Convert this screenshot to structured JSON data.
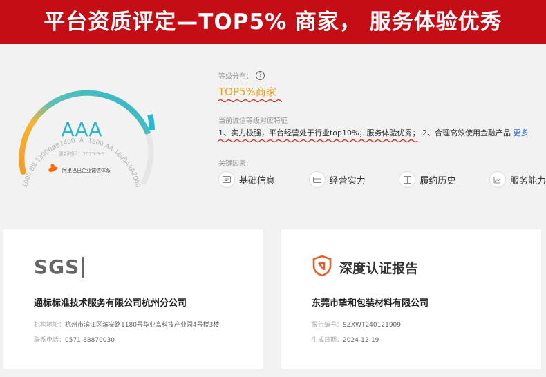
{
  "banner": {
    "title": "平台资质评定—TOP5% 商家， 服务体验优秀"
  },
  "gauge": {
    "grade": "AAA",
    "scale_labels": [
      "1000",
      "BB",
      "1300",
      "BBB",
      "1400",
      "A",
      "1500",
      "AA",
      "1600",
      "AAA",
      "2000"
    ],
    "update_label": "更新时间：",
    "update_date": "2025-3-9",
    "system_name": "阿里巴巴企业诚信体系",
    "colors": {
      "orange": "#f39c26",
      "teal": "#29b7cf",
      "grade": "#2cb6c9",
      "track": "#e6e6e6"
    }
  },
  "info": {
    "level_label": "等级分布：",
    "level_value": "TOP5%商家",
    "feature_label": "当前诚信等级对应特征",
    "feature_text": "1、实力极强，平台经营处于行业top10%；服务体验优秀； 2、合理高效使用金融产品",
    "more": "更多",
    "key_label": "关键因素:",
    "factors": [
      {
        "icon": "id-card-icon",
        "label": "基础信息"
      },
      {
        "icon": "wallet-icon",
        "label": "经营实力"
      },
      {
        "icon": "grid-icon",
        "label": "履约历史"
      },
      {
        "icon": "trend-icon",
        "label": "服务能力"
      }
    ]
  },
  "cards": {
    "left": {
      "logo": "SGS",
      "company": "通标标准技术服务有限公司杭州分公司",
      "address_label": "机构地址：",
      "address": "杭州市滨江区滨安路1180号华业高科技产业园4号楼3楼",
      "phone_label": "联系电话：",
      "phone": "0571-88870030"
    },
    "right": {
      "title": "深度认证报告",
      "company": "东莞市挚和包装材料有限公司",
      "report_label": "报告编号：",
      "report_no": "SZXWT240121909",
      "date_label": "生成日期：",
      "date": "2024-12-19"
    }
  }
}
